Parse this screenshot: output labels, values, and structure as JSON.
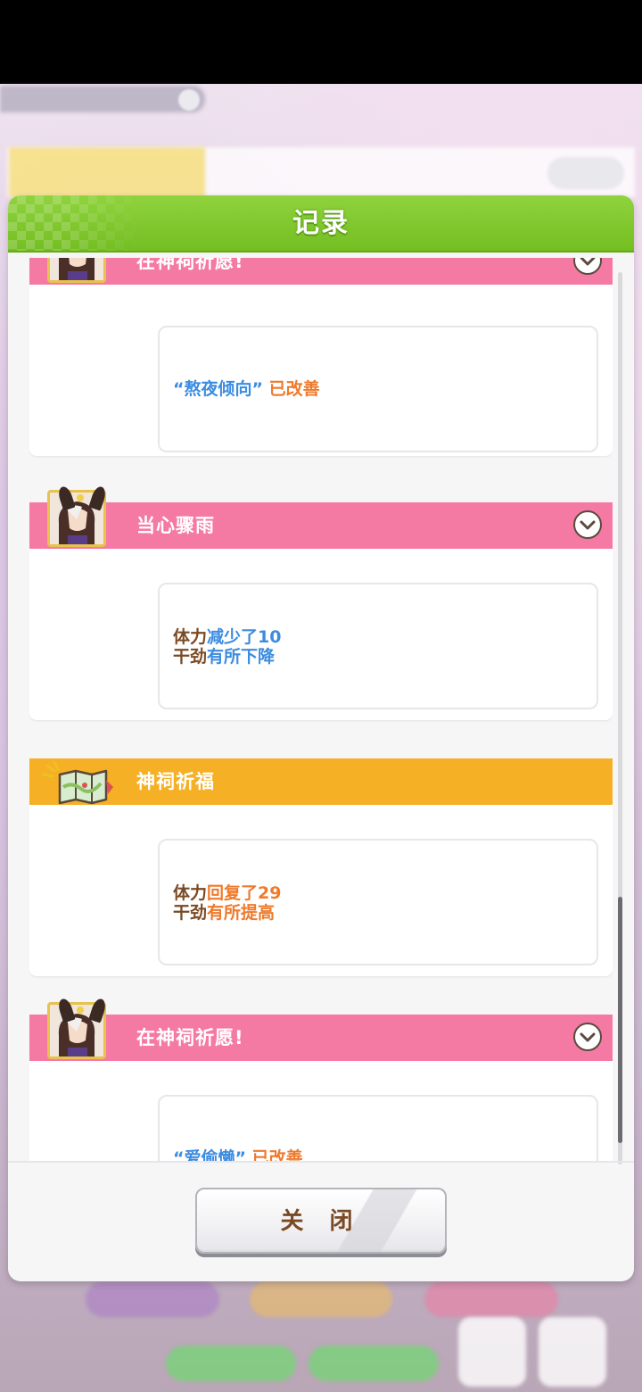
{
  "dialog": {
    "title": "记录",
    "close_label": "关 闭"
  },
  "logs": [
    {
      "title": "在神祠祈愿!",
      "banner_color": "#f57aa3",
      "icon": "horse-girl-portrait",
      "lines": [
        [
          {
            "text": "“熬夜倾向”",
            "color": "blue"
          },
          {
            "text": " 已改善",
            "color": "orange"
          }
        ]
      ]
    },
    {
      "title": "当心骤雨",
      "banner_color": "#f57aa3",
      "icon": "horse-girl-portrait",
      "lines": [
        [
          {
            "text": "体力",
            "color": "brown"
          },
          {
            "text": "减少了10",
            "color": "blue"
          }
        ],
        [
          {
            "text": "干劲",
            "color": "brown"
          },
          {
            "text": "有所下降",
            "color": "blue"
          }
        ]
      ]
    },
    {
      "title": "神祠祈福",
      "banner_color": "#f5b025",
      "icon": "map-icon",
      "lines": [
        [
          {
            "text": "体力",
            "color": "brown"
          },
          {
            "text": "回复了29",
            "color": "orange"
          }
        ],
        [
          {
            "text": "干劲",
            "color": "brown"
          },
          {
            "text": "有所提高",
            "color": "orange"
          }
        ]
      ]
    },
    {
      "title": "在神祠祈愿!",
      "banner_color": "#f57aa3",
      "icon": "horse-girl-portrait",
      "lines": [
        [
          {
            "text": "“爱偷懒”",
            "color": "blue"
          },
          {
            "text": " 已改善",
            "color": "orange"
          }
        ]
      ]
    }
  ],
  "colors": {
    "header_green": "#7ac62a",
    "pink_banner": "#f57aa3",
    "orange_banner": "#f5b025",
    "text_brown": "#7a4a24",
    "text_blue": "#3c8ce0",
    "text_orange": "#ee7a2c"
  }
}
